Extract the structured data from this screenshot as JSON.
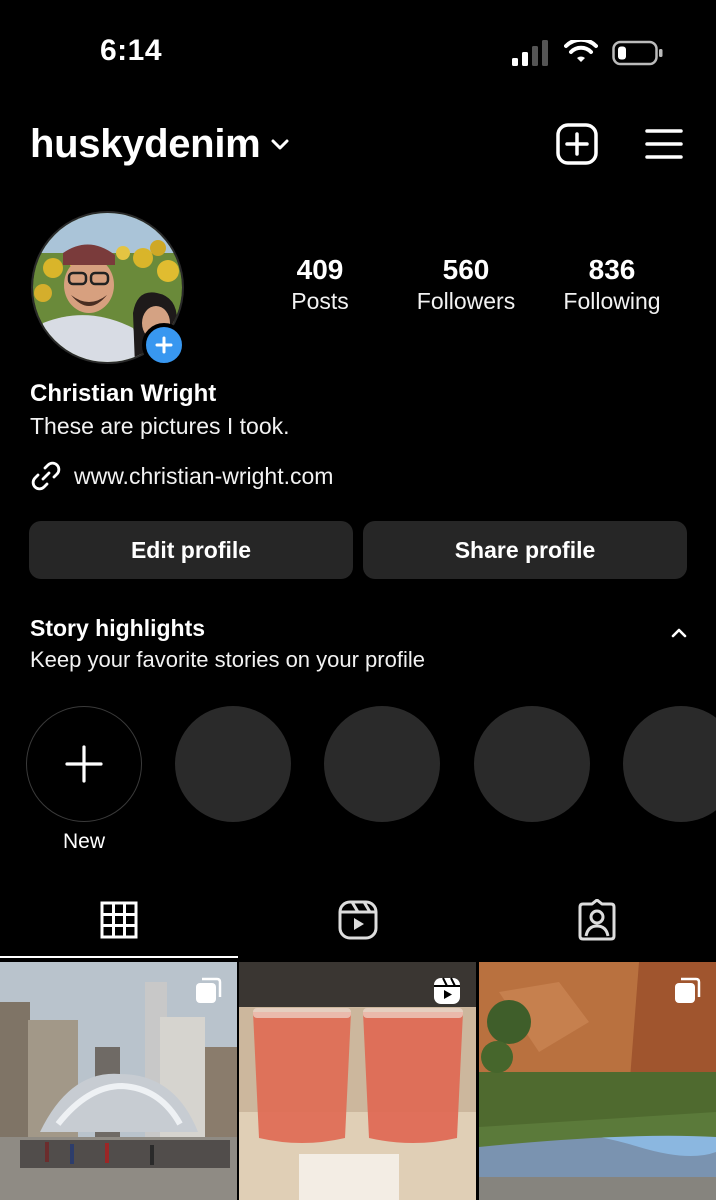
{
  "status_bar": {
    "time": "6:14"
  },
  "header": {
    "username": "husky​denim"
  },
  "profile": {
    "stats": [
      {
        "value": "409",
        "label": "Posts"
      },
      {
        "value": "560",
        "label": "Followers"
      },
      {
        "value": "836",
        "label": "Following"
      }
    ],
    "name": "Christian Wright",
    "bio": "These are pictures I took.",
    "link": "www.christian-wright.com"
  },
  "actions": {
    "edit_label": "Edit profile",
    "share_label": "Share profile"
  },
  "story_highlights": {
    "title": "Story highlights",
    "subtitle": "Keep your favorite stories on your profile",
    "new_label": "New"
  },
  "tabs": [
    "grid-icon",
    "reels-icon",
    "tagged-icon"
  ],
  "grid": [
    {
      "subject": "city-bean-sculpture",
      "badge": "multiple-photos-icon"
    },
    {
      "subject": "two-pink-drinks",
      "badge": "reels-icon"
    },
    {
      "subject": "canyon-river",
      "badge": "multiple-photos-icon"
    }
  ],
  "colors": {
    "background": "#000000",
    "surface": "#262626",
    "accent": "#3897f0"
  }
}
